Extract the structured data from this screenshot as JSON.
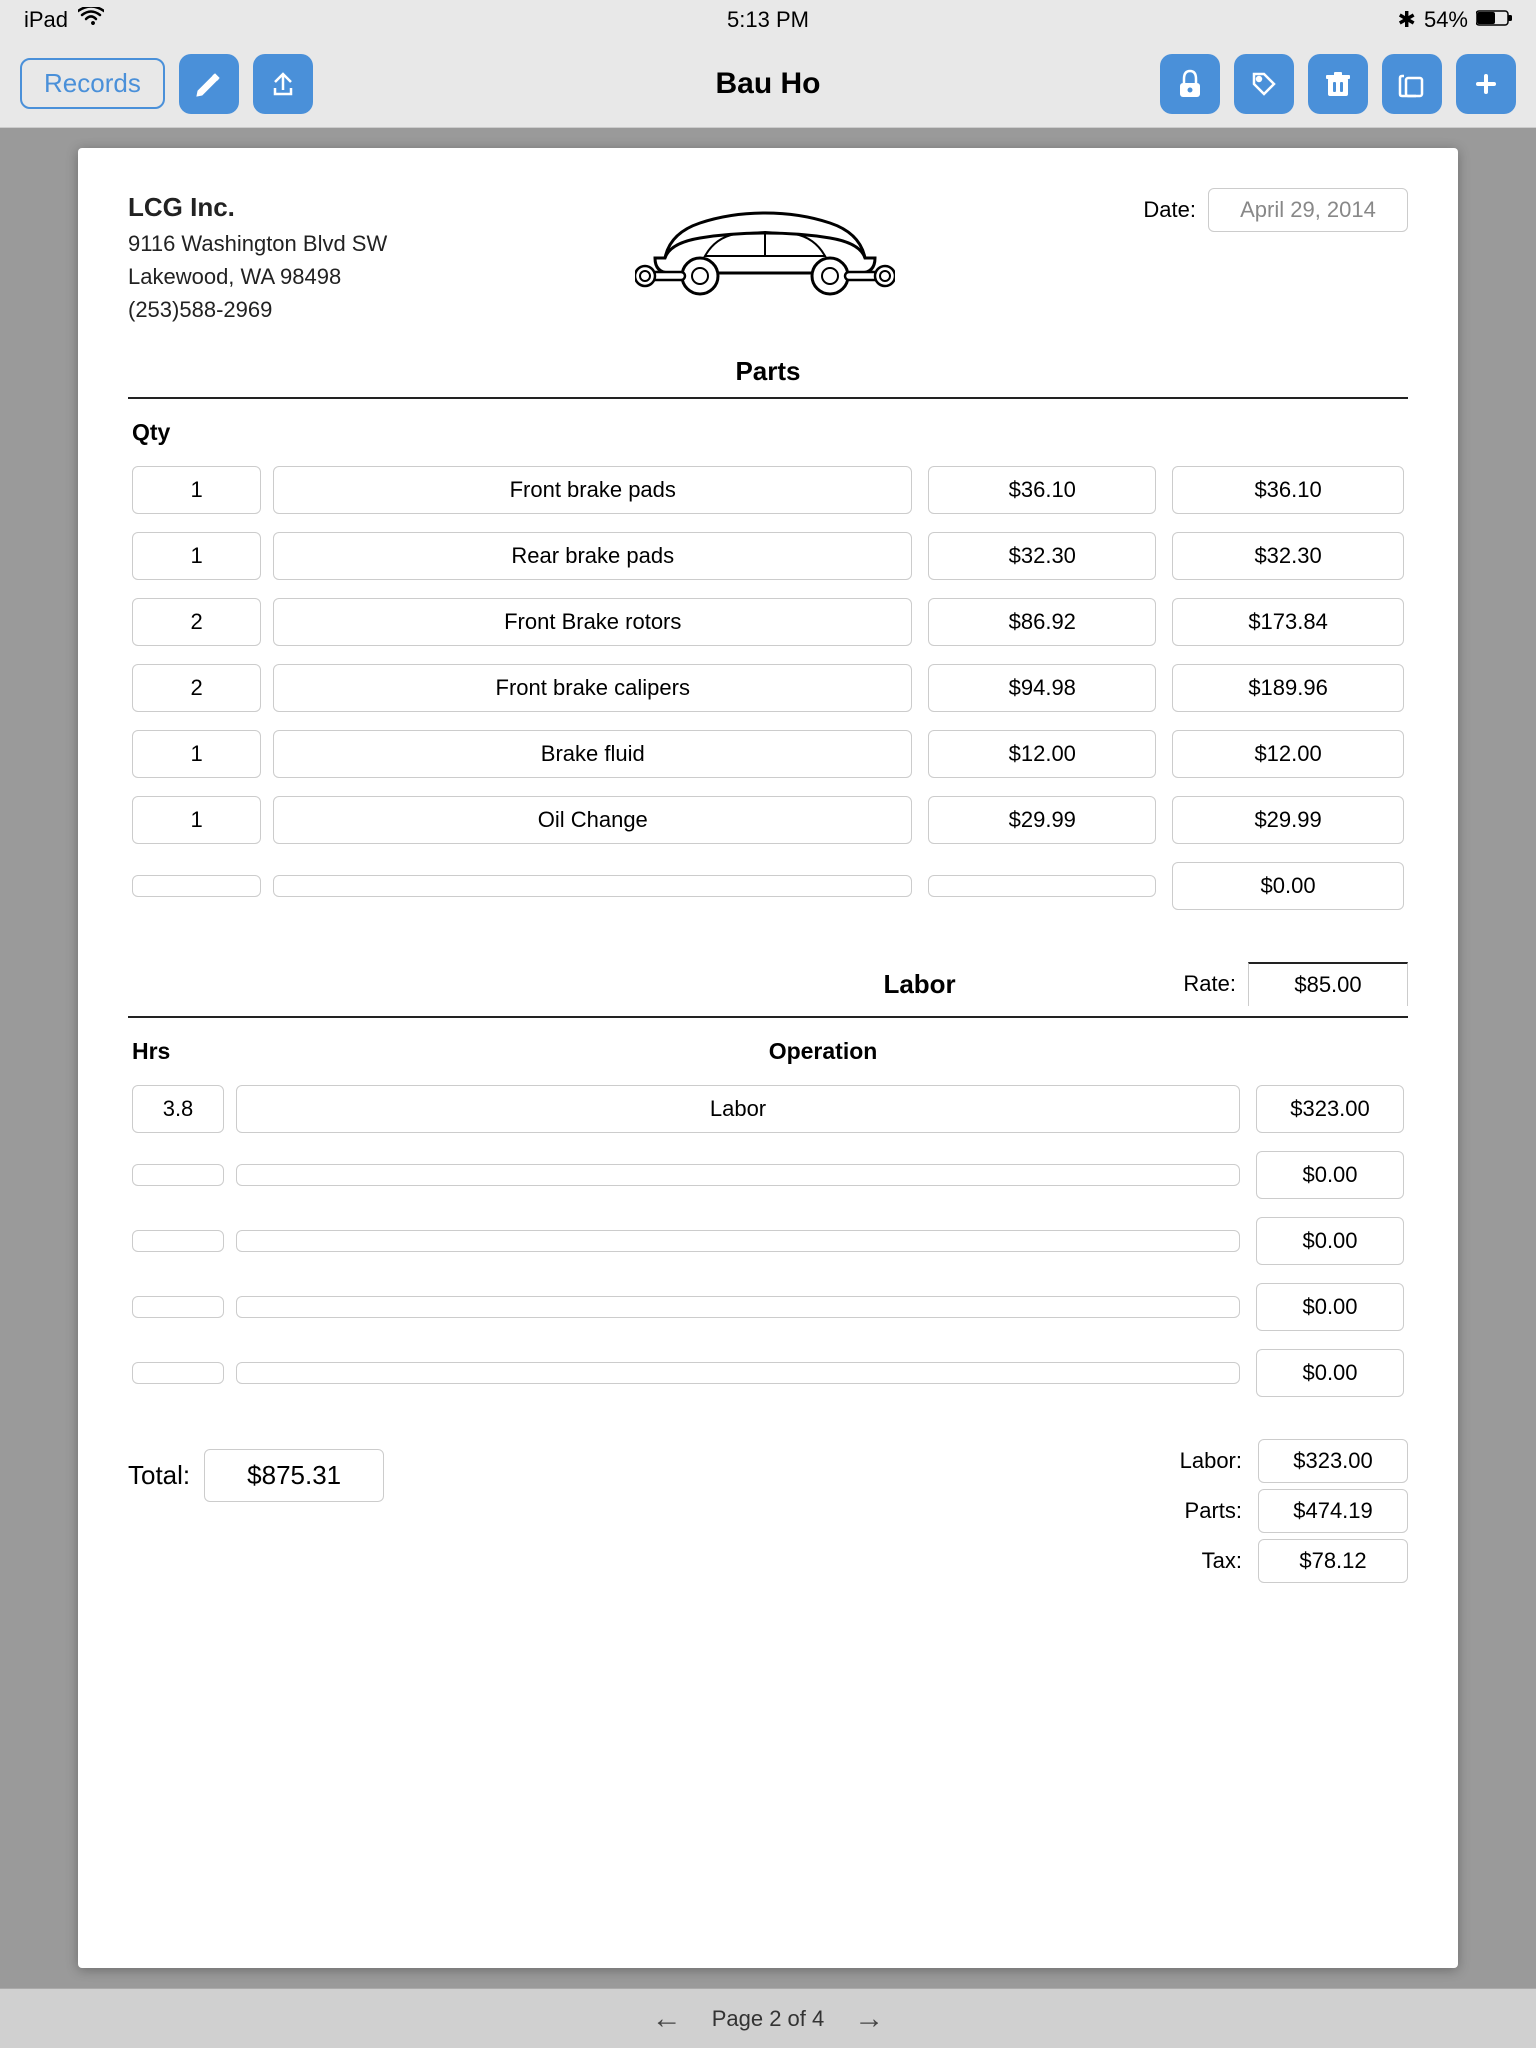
{
  "statusBar": {
    "device": "iPad",
    "wifi": "wifi",
    "time": "5:13 PM",
    "bluetooth": "54%"
  },
  "navBar": {
    "recordsLabel": "Records",
    "title": "Bau Ho"
  },
  "document": {
    "company": {
      "name": "LCG Inc.",
      "address1": "9116 Washington Blvd SW",
      "address2": "Lakewood, WA  98498",
      "phone": "(253)588-2969"
    },
    "dateLabel": "Date:",
    "dateValue": "April 29, 2014",
    "partsSectionTitle": "Parts",
    "qtyLabel": "Qty",
    "parts": [
      {
        "qty": "1",
        "description": "Front brake pads",
        "price": "$36.10",
        "total": "$36.10"
      },
      {
        "qty": "1",
        "description": "Rear brake pads",
        "price": "$32.30",
        "total": "$32.30"
      },
      {
        "qty": "2",
        "description": "Front Brake rotors",
        "price": "$86.92",
        "total": "$173.84"
      },
      {
        "qty": "2",
        "description": "Front brake calipers",
        "price": "$94.98",
        "total": "$189.96"
      },
      {
        "qty": "1",
        "description": "Brake fluid",
        "price": "$12.00",
        "total": "$12.00"
      },
      {
        "qty": "1",
        "description": "Oil Change",
        "price": "$29.99",
        "total": "$29.99"
      },
      {
        "qty": "",
        "description": "",
        "price": "",
        "total": "$0.00"
      }
    ],
    "laborSectionTitle": "Labor",
    "rateLabel": "Rate:",
    "rateValue": "$85.00",
    "hrsLabel": "Hrs",
    "operationLabel": "Operation",
    "laborRows": [
      {
        "hrs": "3.8",
        "operation": "Labor",
        "total": "$323.00"
      },
      {
        "hrs": "",
        "operation": "",
        "total": "$0.00"
      },
      {
        "hrs": "",
        "operation": "",
        "total": "$0.00"
      },
      {
        "hrs": "",
        "operation": "",
        "total": "$0.00"
      },
      {
        "hrs": "",
        "operation": "",
        "total": "$0.00"
      }
    ],
    "laborLabel": "Labor:",
    "laborTotal": "$323.00",
    "totalLabel": "Total:",
    "totalValue": "$875.31",
    "partsLabel": "Parts:",
    "partsTotal": "$474.19",
    "taxLabel": "Tax:",
    "taxTotal": "$78.12",
    "pageIndicator": "Page 2 of 4"
  }
}
